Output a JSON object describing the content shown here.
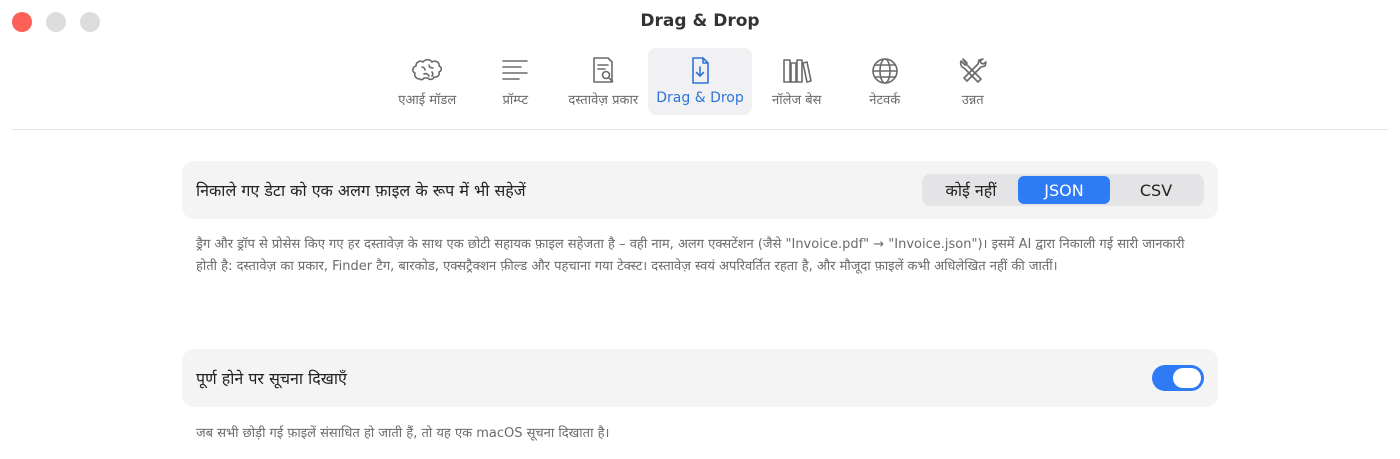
{
  "window": {
    "title": "Drag & Drop"
  },
  "tabs": [
    {
      "label": "एआई मॉडल",
      "icon": "brain-icon"
    },
    {
      "label": "प्रॉम्प्ट",
      "icon": "text-lines-icon"
    },
    {
      "label": "दस्तावेज़ प्रकार",
      "icon": "document-search-icon"
    },
    {
      "label": "Drag & Drop",
      "icon": "document-download-icon",
      "active": true
    },
    {
      "label": "नॉलेज बेस",
      "icon": "books-icon"
    },
    {
      "label": "नेटवर्क",
      "icon": "globe-icon"
    },
    {
      "label": "उन्नत",
      "icon": "tools-icon"
    }
  ],
  "settings": {
    "save_extracted": {
      "label": "निकाले गए डेटा को एक अलग फ़ाइल के रूप में भी सहेजें",
      "options": [
        "कोई नहीं",
        "JSON",
        "CSV"
      ],
      "selected": "JSON",
      "description": "ड्रैग और ड्रॉप से प्रोसेस किए गए हर दस्तावेज़ के साथ एक छोटी सहायक फ़ाइल सहेजता है – वही नाम, अलग एक्सटेंशन (जैसे \"Invoice.pdf\" → \"Invoice.json\")। इसमें AI द्वारा निकाली गई सारी जानकारी होती है: दस्तावेज़ का प्रकार, Finder टैग, बारकोड, एक्सट्रैक्शन फ़ील्ड और पहचाना गया टेक्स्ट। दस्तावेज़ स्वयं अपरिवर्तित रहता है, और मौजूदा फ़ाइलें कभी अधिलेखित नहीं की जातीं।"
    },
    "notify": {
      "label": "पूर्ण होने पर सूचना दिखाएँ",
      "enabled": true,
      "description": "जब सभी छोड़ी गई फ़ाइलें संसाधित हो जाती हैं, तो यह एक macOS सूचना दिखाता है।"
    }
  },
  "colors": {
    "accent": "#2f7bf6",
    "close": "#fe5f57"
  }
}
